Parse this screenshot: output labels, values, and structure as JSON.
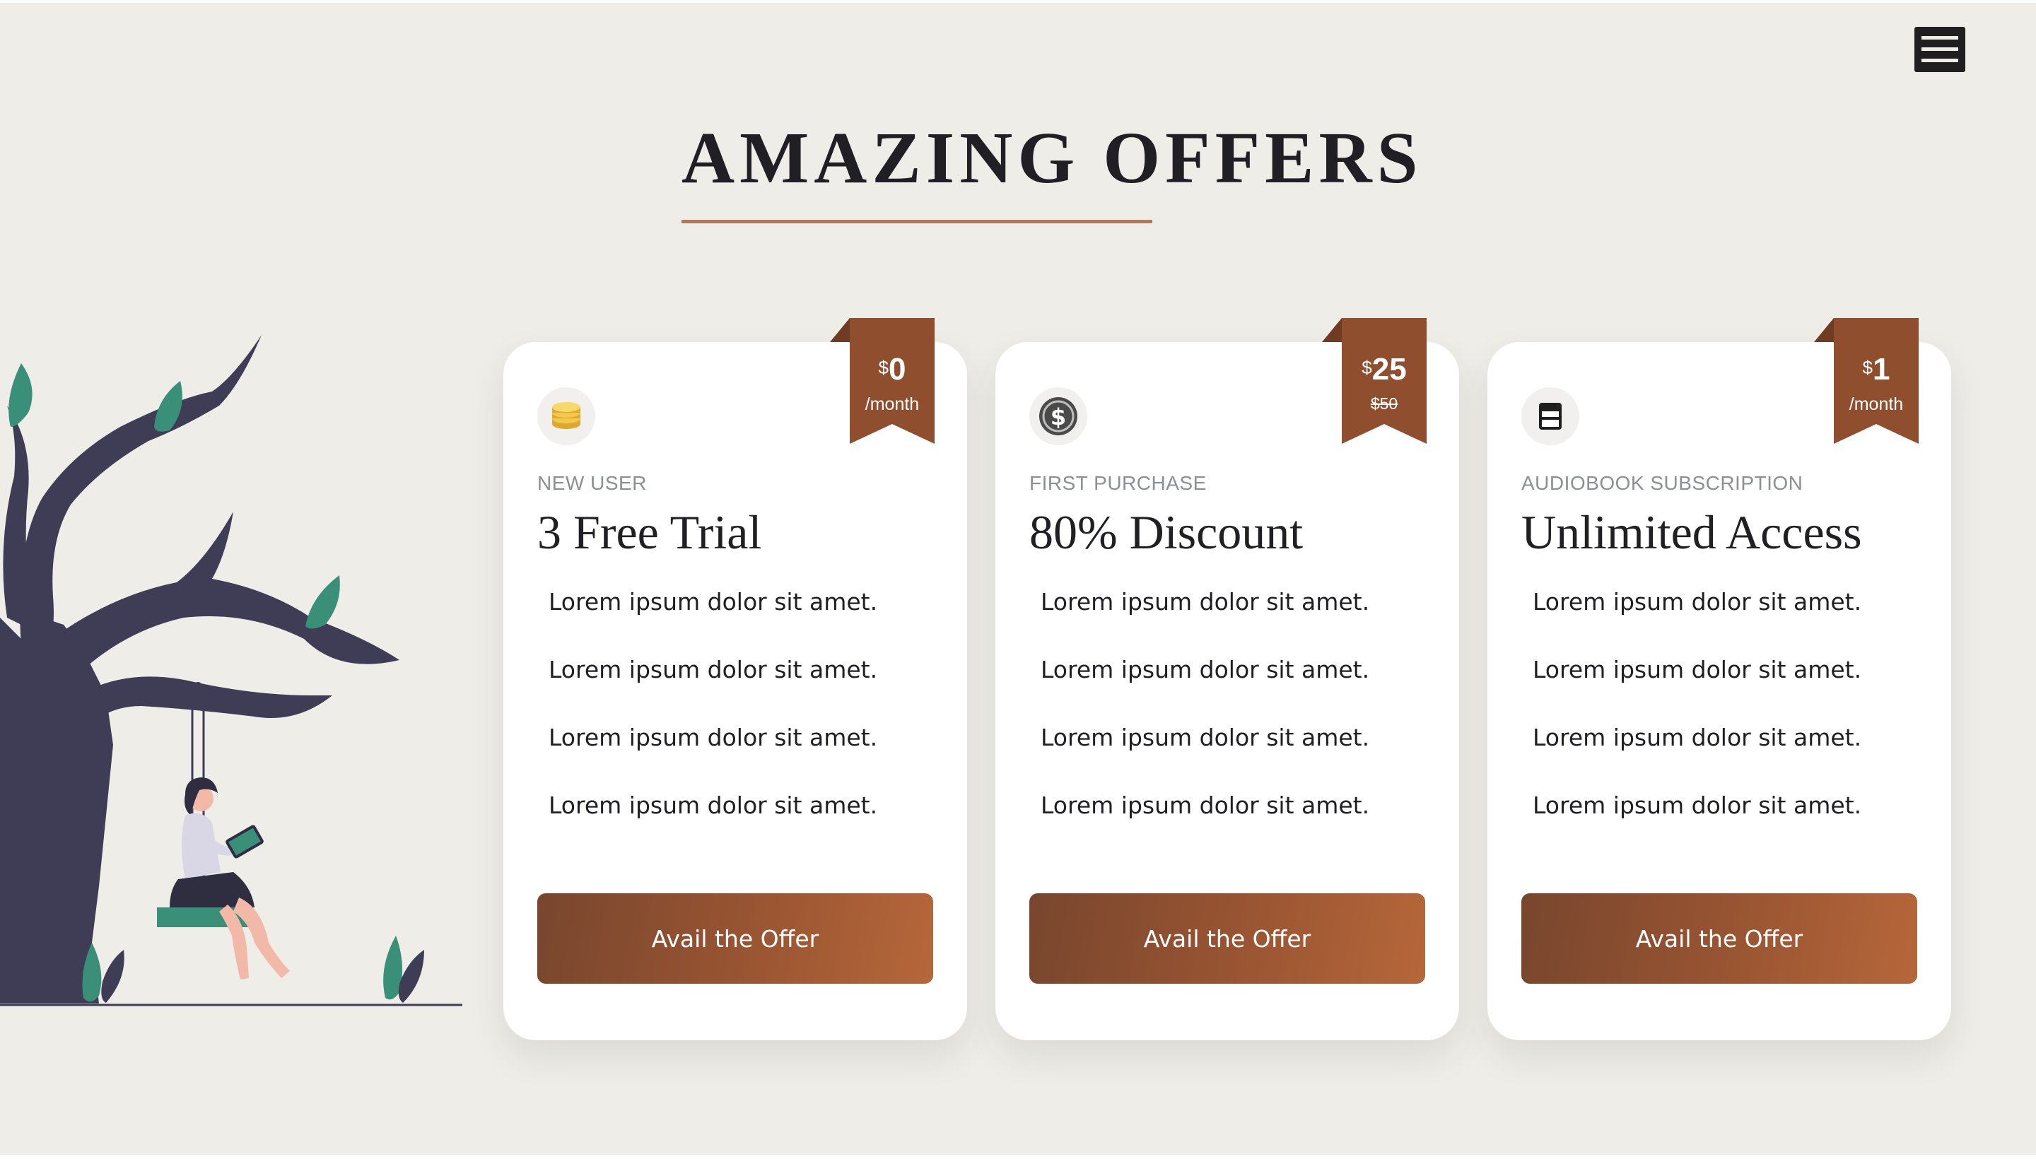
{
  "header": {
    "title": "AMAZING OFFERS",
    "menu_icon": "hamburger-menu-icon"
  },
  "colors": {
    "background": "#efede8",
    "accent": "#b2785b",
    "ribbon": "#8f4f2f",
    "button_start": "#78462e",
    "button_end": "#b6673a",
    "tree": "#3f3d56",
    "leaf": "#3a8f78"
  },
  "offers": [
    {
      "icon": "coins-icon",
      "price_currency": "$",
      "price_amount": "0",
      "price_sub": "/month",
      "category": "NEW USER",
      "title": "3 Free Trial",
      "features": [
        "Lorem ipsum dolor sit amet.",
        "Lorem ipsum dolor sit amet.",
        "Lorem ipsum dolor sit amet.",
        "Lorem ipsum dolor sit amet."
      ],
      "button_label": "Avail the Offer"
    },
    {
      "icon": "dollar-coin-icon",
      "price_currency": "$",
      "price_amount": "25",
      "price_sub": "$50",
      "category": "FIRST PURCHASE",
      "title": "80% Discount",
      "features": [
        "Lorem ipsum dolor sit amet.",
        "Lorem ipsum dolor sit amet.",
        "Lorem ipsum dolor sit amet.",
        "Lorem ipsum dolor sit amet."
      ],
      "button_label": "Avail the Offer"
    },
    {
      "icon": "calendar-card-icon",
      "price_currency": "$",
      "price_amount": "1",
      "price_sub": "/month",
      "category": "AUDIOBOOK SUBSCRIPTION",
      "title": "Unlimited Access",
      "features": [
        "Lorem ipsum dolor sit amet.",
        "Lorem ipsum dolor sit amet.",
        "Lorem ipsum dolor sit amet.",
        "Lorem ipsum dolor sit amet."
      ],
      "button_label": "Avail the Offer"
    }
  ],
  "illustration": {
    "icon": "woman-reading-on-swing-illustration"
  }
}
